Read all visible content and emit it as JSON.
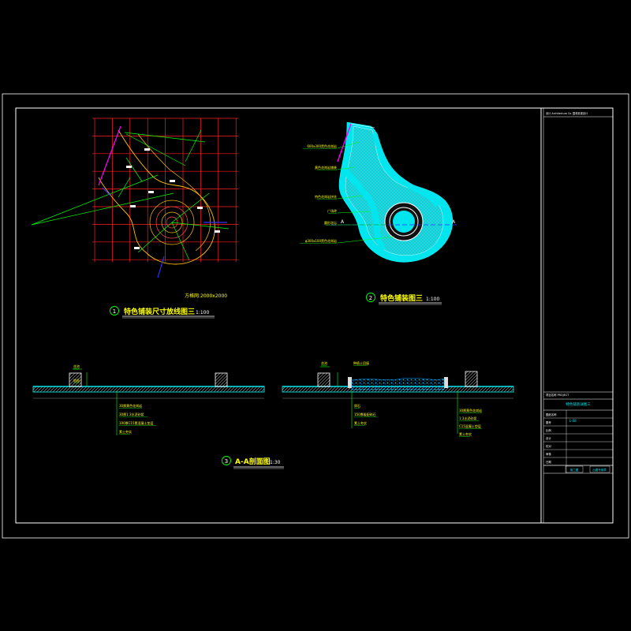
{
  "titles": {
    "plan1_number": "1",
    "plan1_title": "特色铺装尺寸放线图三",
    "plan1_scale": "1:100",
    "plan1_grid_note": "方格网:2000x2000",
    "plan2_number": "2",
    "plan2_title": "特色铺装图三",
    "plan2_scale": "1:100",
    "section_number": "3",
    "section_title": "A-A剖面图",
    "section_scale": "1:30"
  },
  "section_marks": {
    "left": "A",
    "right": "A"
  },
  "plan2_labels": [
    "600x300黑色花岗岩",
    "黄色花岗岩铺装",
    "特色花岗岩拼花",
    "广场砖",
    "圆形花坛",
    "φ300x100黑色花岗岩"
  ],
  "section_left_top_labels": [
    "花池",
    "地面"
  ],
  "section_left_labels": [
    "30厚黄色花岗岩",
    "30厚1:3水泥砂浆",
    "100厚C15素混凝土垫层",
    "素土夯实"
  ],
  "section_right_top_labels": [
    "花池",
    "种植土回填"
  ],
  "section_mid_labels": [
    "卵石",
    "150厚级配碎石",
    "素土夯实"
  ],
  "section_right_labels": [
    "30厚黄色花岗岩",
    "1:3水泥砂浆",
    "C15混凝土垫层",
    "素土夯实"
  ],
  "title_block": {
    "header": "设计  Architecture Co.   园林景观设计",
    "project_label": "项目名称  PROJECT",
    "drawing_title": "特色铺装详图三",
    "drawing_no": "L-08",
    "rows": [
      "图纸名称",
      "图号",
      "比例",
      "设计",
      "校对",
      "审核",
      "日期"
    ],
    "stamp_left": "施工图",
    "stamp_right": "出图专用章"
  },
  "colors": {
    "frame": "#ffffff",
    "grid": "#ff2020",
    "dims": "#00ff00",
    "paving": "#ffc000",
    "cyan": "#00e5ee",
    "magenta": "#ff00ff",
    "blue": "#3030ff",
    "label_text": "#ffff00"
  }
}
